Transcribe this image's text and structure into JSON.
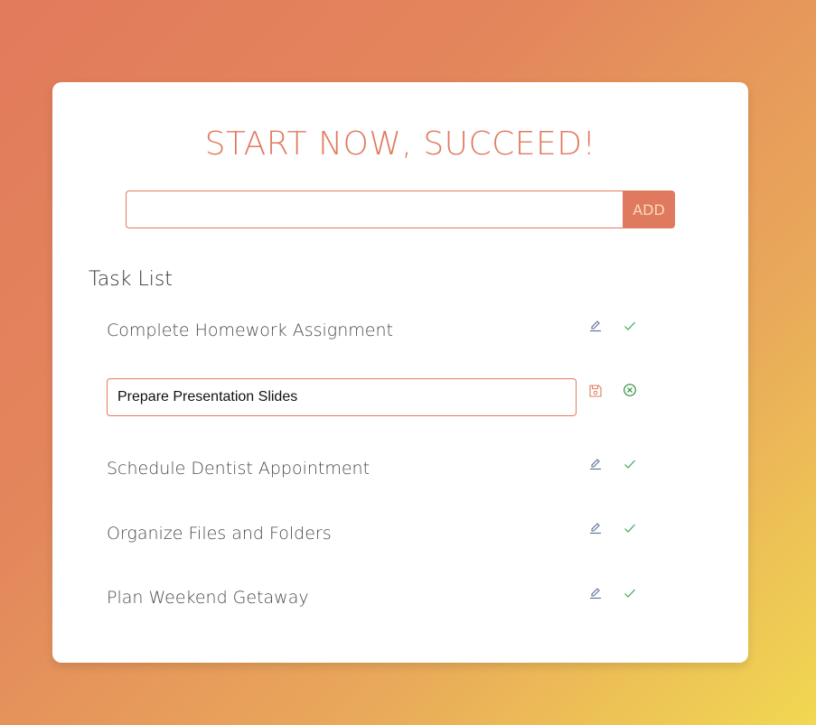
{
  "header": {
    "title": "START NOW, SUCCEED!"
  },
  "add_task": {
    "input_value": "",
    "input_placeholder": "",
    "button_label": "ADD"
  },
  "task_list": {
    "heading": "Task List",
    "tasks": [
      {
        "label": "Complete Homework Assignment",
        "editing": false,
        "icons": [
          "pencil-icon",
          "checkmark-icon"
        ]
      },
      {
        "label": "Prepare Presentation Slides",
        "editing": true,
        "icons": [
          "floppy-disk-icon",
          "cancel-circle-icon"
        ]
      },
      {
        "label": "Schedule Dentist Appointment",
        "editing": false,
        "icons": [
          "pencil-icon",
          "checkmark-icon"
        ]
      },
      {
        "label": "Organize Files and Folders",
        "editing": false,
        "icons": [
          "pencil-icon",
          "checkmark-icon"
        ]
      },
      {
        "label": "Plan Weekend Getaway",
        "editing": false,
        "icons": [
          "pencil-icon",
          "checkmark-icon"
        ]
      }
    ]
  },
  "colors": {
    "accent": "#e07a5f",
    "edit_icon": "#5b6b9a",
    "check_icon": "#3aa55a",
    "save_icon": "#e07a5f",
    "cancel_icon": "#2f8f3a",
    "card_background": "#ffffff",
    "gradient_start": "#e27a5c",
    "gradient_end": "#f1d852"
  }
}
